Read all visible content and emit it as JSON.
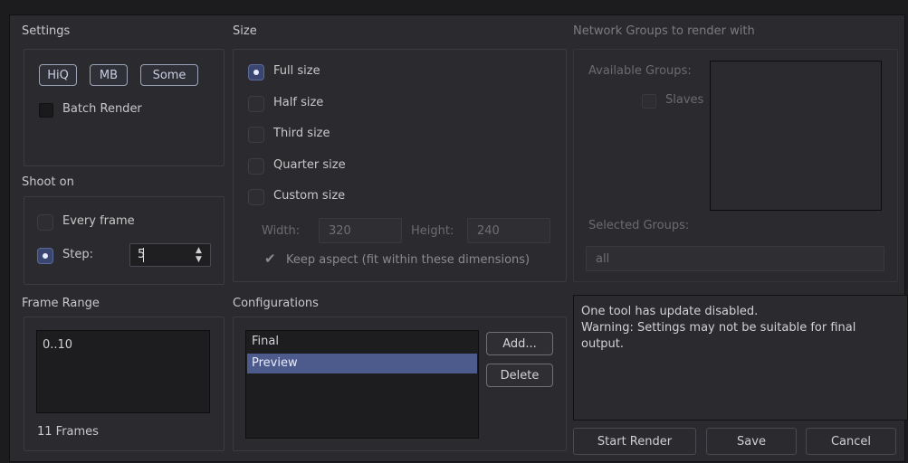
{
  "settings": {
    "title": "Settings",
    "toggles": [
      "HiQ",
      "MB",
      "Some"
    ],
    "batch_render_label": "Batch Render"
  },
  "shoot_on": {
    "title": "Shoot on",
    "every_frame_label": "Every frame",
    "step_label": "Step:",
    "step_value": "5"
  },
  "frame_range": {
    "title": "Frame Range",
    "value": "0..10",
    "frames_label": "11 Frames"
  },
  "size": {
    "title": "Size",
    "options": [
      "Full size",
      "Half size",
      "Third size",
      "Quarter size",
      "Custom size"
    ],
    "selected": "Full size",
    "width_label": "Width:",
    "width_value": "320",
    "height_label": "Height:",
    "height_value": "240",
    "keep_aspect_label": "Keep aspect (fit within these dimensions)"
  },
  "configurations": {
    "title": "Configurations",
    "items": [
      "Final",
      "Preview"
    ],
    "selected": "Preview",
    "add_label": "Add...",
    "delete_label": "Delete"
  },
  "network": {
    "title": "Network Groups to render with",
    "available_label": "Available Groups:",
    "slaves_label": "Slaves",
    "selected_label": "Selected Groups:",
    "selected_value": "all"
  },
  "messages": {
    "line1": "One tool has update disabled.",
    "line2": "Warning: Settings may not be suitable for final output."
  },
  "footer": {
    "start_render": "Start Render",
    "save": "Save",
    "cancel": "Cancel"
  },
  "colors": {
    "background": "#2b2b2f",
    "accent": "#3b4670",
    "selection": "#4d5a8c"
  }
}
